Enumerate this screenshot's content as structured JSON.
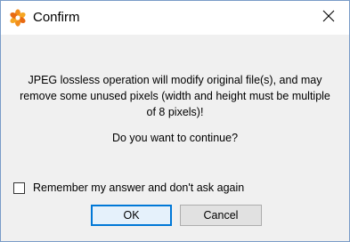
{
  "window": {
    "title": "Confirm",
    "icon": "xnview-flower-icon"
  },
  "message": {
    "line1": "JPEG lossless operation will modify original file(s), and may",
    "line2": "remove some unused pixels (width and height must be multiple",
    "line3": "of 8 pixels)!",
    "question": "Do you want to continue?"
  },
  "remember": {
    "label": "Remember my answer and don't ask again",
    "checked": false
  },
  "buttons": {
    "ok": "OK",
    "cancel": "Cancel"
  },
  "colors": {
    "focus_border": "#0078d7",
    "dialog_bg": "#f0f0f0"
  }
}
